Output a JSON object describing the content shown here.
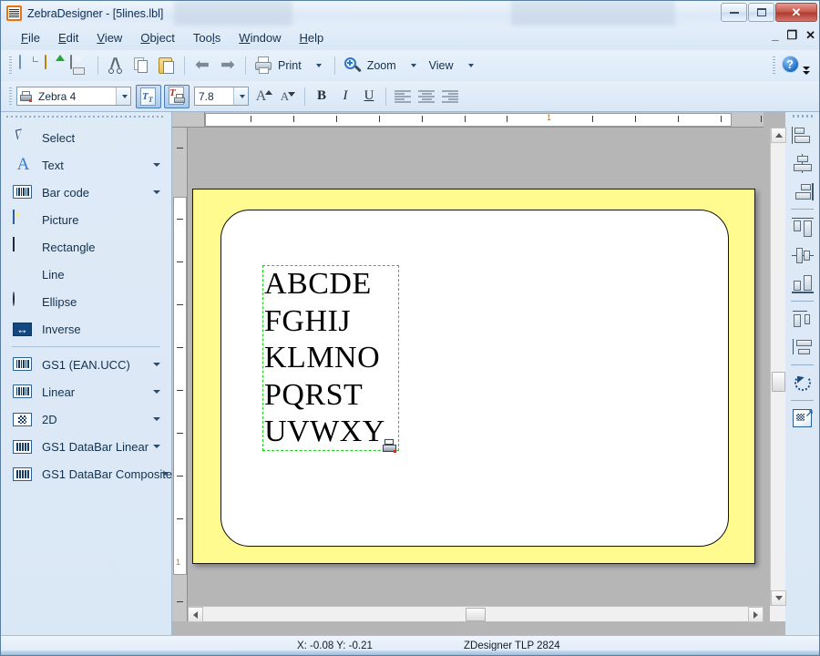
{
  "window": {
    "title": "ZebraDesigner - [5lines.lbl]",
    "app_icon": "label-printer-icon",
    "controls": {
      "minimize": "minimize-icon",
      "maximize": "maximize-icon",
      "close": "✕"
    }
  },
  "mdi_controls": {
    "minimize": "_",
    "restore": "❐",
    "close": "✕"
  },
  "menubar": {
    "items": [
      {
        "label": "File",
        "accel": "F"
      },
      {
        "label": "Edit",
        "accel": "E"
      },
      {
        "label": "View",
        "accel": "V"
      },
      {
        "label": "Object",
        "accel": "O"
      },
      {
        "label": "Tools",
        "accel": "l"
      },
      {
        "label": "Window",
        "accel": "W"
      },
      {
        "label": "Help",
        "accel": "H"
      }
    ]
  },
  "toolbar_main": {
    "buttons": [
      {
        "name": "new",
        "icon": "new-document-icon"
      },
      {
        "name": "open",
        "icon": "open-folder-icon"
      },
      {
        "name": "save",
        "icon": "save-floppy-icon"
      },
      {
        "name": "cut",
        "icon": "scissors-icon"
      },
      {
        "name": "copy",
        "icon": "copy-icon"
      },
      {
        "name": "paste",
        "icon": "paste-clipboard-icon"
      },
      {
        "name": "undo",
        "icon": "undo-arrow-icon"
      },
      {
        "name": "redo",
        "icon": "redo-arrow-icon"
      }
    ],
    "print_label": "Print",
    "zoom_label": "Zoom",
    "view_label": "View",
    "help_icon": "help-question-icon"
  },
  "toolbar_format": {
    "printer_combo_value": "Zebra 4",
    "toggle_text_label": "text-object-toggle",
    "toggle_printer_label": "printer-font-toggle",
    "font_size": "7.8",
    "grow_font": "A",
    "shrink_font": "A",
    "bold": "B",
    "italic": "I",
    "underline": "U",
    "align_left": "align-left-icon",
    "align_center": "align-center-icon",
    "align_right": "align-right-icon"
  },
  "toolbox": {
    "items": [
      {
        "label": "Select",
        "icon": "cursor-arrow-icon",
        "dropdown": false
      },
      {
        "label": "Text",
        "icon": "text-a-icon",
        "dropdown": true
      },
      {
        "label": "Bar code",
        "icon": "barcode-icon",
        "dropdown": true
      },
      {
        "label": "Picture",
        "icon": "picture-image-icon",
        "dropdown": false
      },
      {
        "label": "Rectangle",
        "icon": "rectangle-icon",
        "dropdown": false
      },
      {
        "label": "Line",
        "icon": "line-icon",
        "dropdown": false
      },
      {
        "label": "Ellipse",
        "icon": "ellipse-icon",
        "dropdown": false
      },
      {
        "label": "Inverse",
        "icon": "inverse-arrows-icon",
        "dropdown": false
      }
    ],
    "items2": [
      {
        "label": "GS1 (EAN.UCC)",
        "icon": "barcode-icon",
        "dropdown": true
      },
      {
        "label": "Linear",
        "icon": "barcode-icon",
        "dropdown": true
      },
      {
        "label": "2D",
        "icon": "datamatrix-icon",
        "dropdown": true
      },
      {
        "label": "GS1 DataBar Linear",
        "icon": "databar-icon",
        "dropdown": true
      },
      {
        "label": "GS1 DataBar Composite",
        "icon": "databar-icon",
        "dropdown": true
      }
    ]
  },
  "align_toolbar": {
    "items": [
      {
        "name": "align-left",
        "icon": "align-objects-left-icon"
      },
      {
        "name": "align-center-horiz",
        "icon": "align-objects-center-icon"
      },
      {
        "name": "align-right",
        "icon": "align-objects-right-icon"
      },
      {
        "name": "align-top",
        "icon": "align-objects-top-icon"
      },
      {
        "name": "align-middle",
        "icon": "align-objects-middle-icon"
      },
      {
        "name": "align-bottom",
        "icon": "align-objects-bottom-icon"
      },
      {
        "name": "space-horizontally",
        "icon": "distribute-horizontal-icon"
      },
      {
        "name": "space-vertically",
        "icon": "distribute-vertical-icon"
      },
      {
        "name": "rotate",
        "icon": "rotate-icon"
      },
      {
        "name": "object-properties",
        "icon": "object-properties-icon"
      }
    ]
  },
  "canvas": {
    "label_background": "#fffb8f",
    "label_media": "#ffffff",
    "selection_color": "#18d318",
    "ruler_marks_h": [
      "1"
    ],
    "text_object": {
      "lines": [
        "ABCDE",
        "FGHIJ",
        "KLMNO",
        "PQRST",
        "UVWXY"
      ],
      "badge_icon": "printer-font-badge-icon",
      "selected": true
    }
  },
  "statusbar": {
    "coordinates": "X: -0.08 Y: -0.21",
    "printer": "ZDesigner TLP 2824"
  }
}
